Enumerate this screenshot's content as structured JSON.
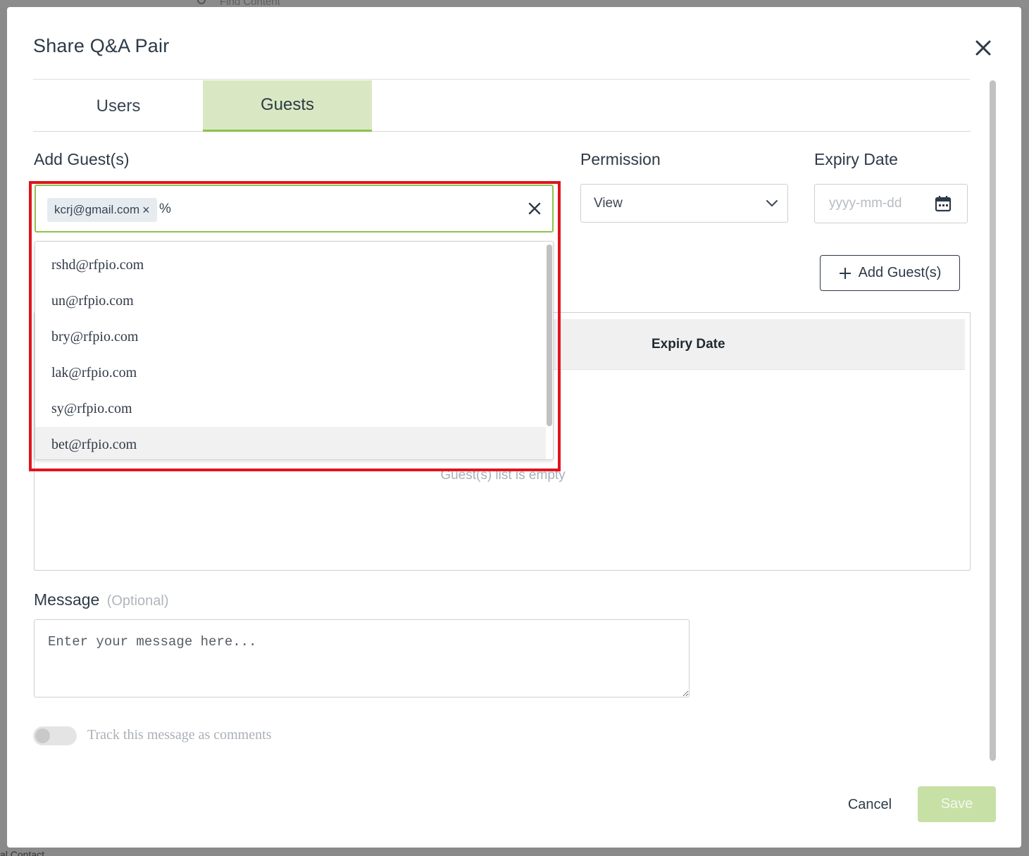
{
  "backdrop": {
    "search_placeholder": "Find Content",
    "bottom_text": "al Contact"
  },
  "modal": {
    "title": "Share Q&A Pair"
  },
  "tabs": [
    {
      "label": "Users",
      "active": false
    },
    {
      "label": "Guests",
      "active": true
    }
  ],
  "add_guests": {
    "label": "Add Guest(s)",
    "chips": [
      {
        "email": "kcrj@gmail.com",
        "remove": "×"
      }
    ],
    "typed": "%",
    "suggestions": [
      "rshd@rfpio.com",
      "un@rfpio.com",
      "bry@rfpio.com",
      "lak@rfpio.com",
      "sy@rfpio.com",
      "bet@rfpio.com"
    ],
    "button_label": "Add Guest(s)"
  },
  "permission": {
    "label": "Permission",
    "selected": "View"
  },
  "expiry": {
    "label": "Expiry Date",
    "placeholder": "yyyy-mm-dd"
  },
  "guest_table": {
    "columns": [
      "Expiry Date"
    ],
    "empty_text": "Guest(s) list is empty"
  },
  "message": {
    "label": "Message",
    "optional": "(Optional)",
    "placeholder": "Enter your message here..."
  },
  "track_toggle": {
    "label": "Track this message as comments",
    "on": false
  },
  "footer": {
    "cancel": "Cancel",
    "save": "Save"
  },
  "colors": {
    "accent_green": "#8bc34a",
    "tab_active_bg": "#d9e8c2",
    "save_disabled_bg": "#c7e0a6",
    "highlight_red": "#e0141e"
  }
}
